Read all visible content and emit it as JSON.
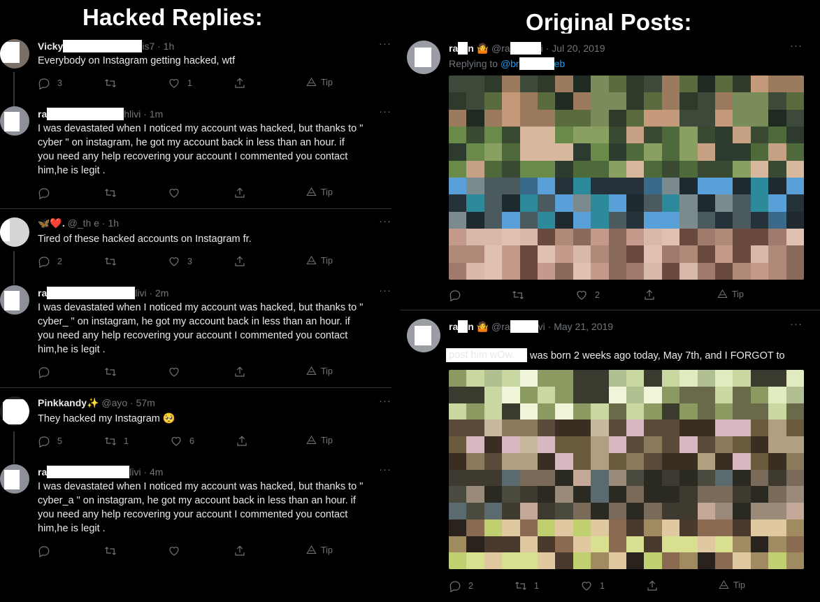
{
  "headings": {
    "left": "Hacked Replies:",
    "right": "Original Posts:"
  },
  "left_tweets": [
    {
      "name": "Vicky",
      "handle": "is7 · 1h",
      "text": "Everybody on Instagram getting hacked, wtf",
      "reply": "3",
      "retweet": "",
      "like": "1",
      "tip": "Tip"
    },
    {
      "name": "ra",
      "handle": "hlivi · 1m",
      "text": "I was devastated when I noticed my account was hacked, but thanks to  \"\ncyber         \" on instagram, he got my account back in less than an hour. if\nyou need any help recovering your account I commented you  contact\nhim,he is legit .",
      "reply": "",
      "retweet": "",
      "like": "",
      "tip": "Tip"
    },
    {
      "name": "🦋❤️.",
      "handle": "@_th                e · 1h",
      "text": "Tired of these hacked accounts on Instagram fr.",
      "reply": "2",
      "retweet": "",
      "like": "3",
      "tip": "Tip"
    },
    {
      "name": "ra",
      "handle": "livi · 2m",
      "text": "I was devastated when I noticed my account was hacked, but thanks to  \"\ncyber_          \" on instagram, he got my account back in less than an hour. if\nyou need any help recovering your account I commented you  contact\nhim,he is legit .",
      "reply": "",
      "retweet": "",
      "like": "",
      "tip": "Tip"
    },
    {
      "name": "Pinkkandy✨",
      "handle": "@ayo               · 57m",
      "text": "They hacked my Instagram 🥺",
      "reply": "5",
      "retweet": "1",
      "like": "6",
      "tip": "Tip"
    },
    {
      "name": "ra",
      "handle": "livi · 4m",
      "text": "I was devastated when I noticed my account was hacked, but thanks to  \"\ncyber_a         \" on instagram, he got my account back in less than an hour. if\nyou need any help recovering your account I commented you  contact\nhim,he is legit .",
      "reply": "",
      "retweet": "",
      "like": "",
      "tip": "Tip"
    }
  ],
  "right_tweets": [
    {
      "name": "ra",
      "name2": "n 🤷",
      "handle": "@ra",
      "handle2": "i · Jul 20, 2019",
      "reply_to_label": "Replying to ",
      "reply_to_user": "@br",
      "reply_to_user2": "eb",
      "text": "",
      "reply": "",
      "retweet": "",
      "like": "2",
      "tip": "Tip"
    },
    {
      "name": "ra",
      "name2": "n 🤷",
      "handle": "@ra",
      "handle2": "vi · May 21, 2019",
      "text_line1": "was born 2 weeks ago today, May 7th, and I FORGOT to",
      "text_line2": "post him wOw.",
      "reply": "2",
      "retweet": "1",
      "like": "1",
      "tip": "Tip"
    }
  ],
  "colors": {
    "background": "#000000",
    "text": "#e7e9ea",
    "muted": "#71767b",
    "link": "#1d9bf0",
    "divider": "#2f3336"
  },
  "icons": [
    "reply-icon",
    "retweet-icon",
    "like-icon",
    "share-icon",
    "tip-icon",
    "more-icon"
  ]
}
